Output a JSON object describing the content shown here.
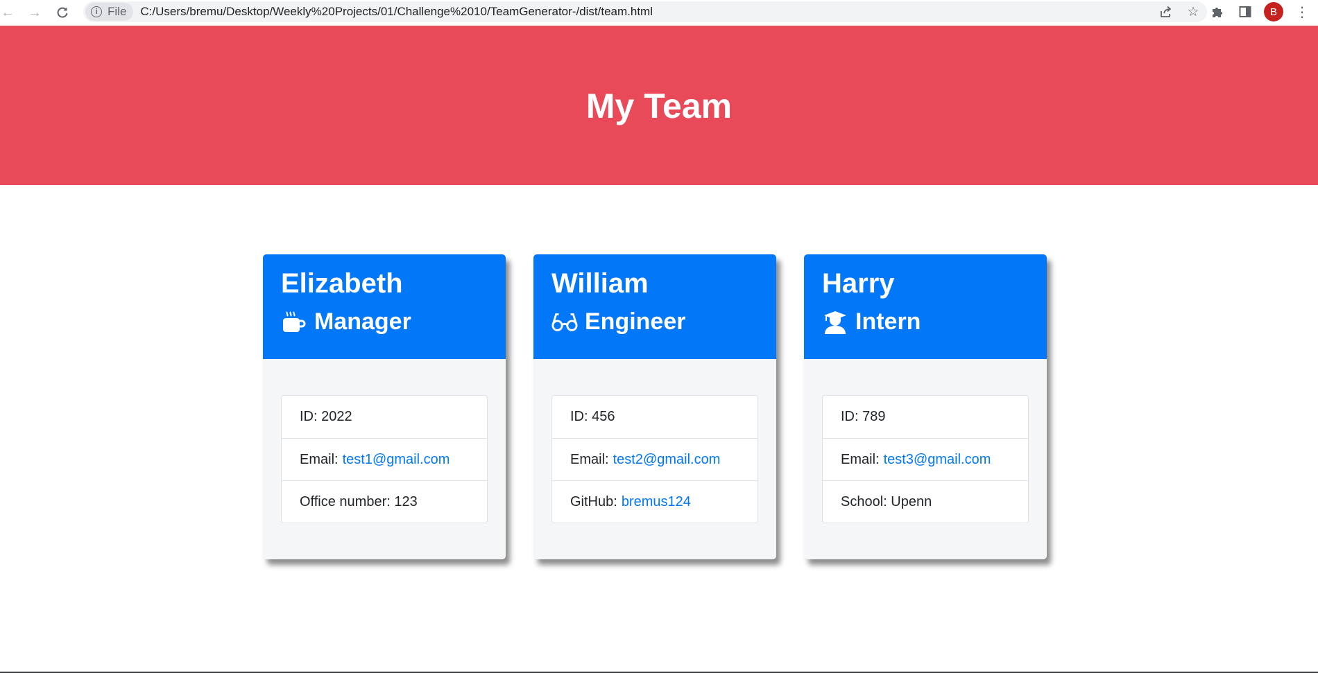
{
  "browser": {
    "site_chip_label": "File",
    "url": "C:/Users/bremu/Desktop/Weekly%20Projects/01/Challenge%2010/TeamGenerator-/dist/team.html",
    "avatar_letter": "B"
  },
  "header": {
    "title": "My Team"
  },
  "colors": {
    "banner": "#e84a59",
    "card_header": "#0277f7",
    "link": "#0277f7"
  },
  "team": [
    {
      "name": "Elizabeth",
      "role": "Manager",
      "icon": "coffee-mug-icon",
      "id_label": "ID:",
      "id_value": "2022",
      "email_label": "Email:",
      "email": "test1@gmail.com",
      "extra_label": "Office number:",
      "extra_value": "123"
    },
    {
      "name": "William",
      "role": "Engineer",
      "icon": "glasses-icon",
      "id_label": "ID:",
      "id_value": "456",
      "email_label": "Email:",
      "email": "test2@gmail.com",
      "extra_label": "GitHub:",
      "extra_value": "bremus124"
    },
    {
      "name": "Harry",
      "role": "Intern",
      "icon": "graduate-icon",
      "id_label": "ID:",
      "id_value": "789",
      "email_label": "Email:",
      "email": "test3@gmail.com",
      "extra_label": "School:",
      "extra_value": "Upenn"
    }
  ]
}
